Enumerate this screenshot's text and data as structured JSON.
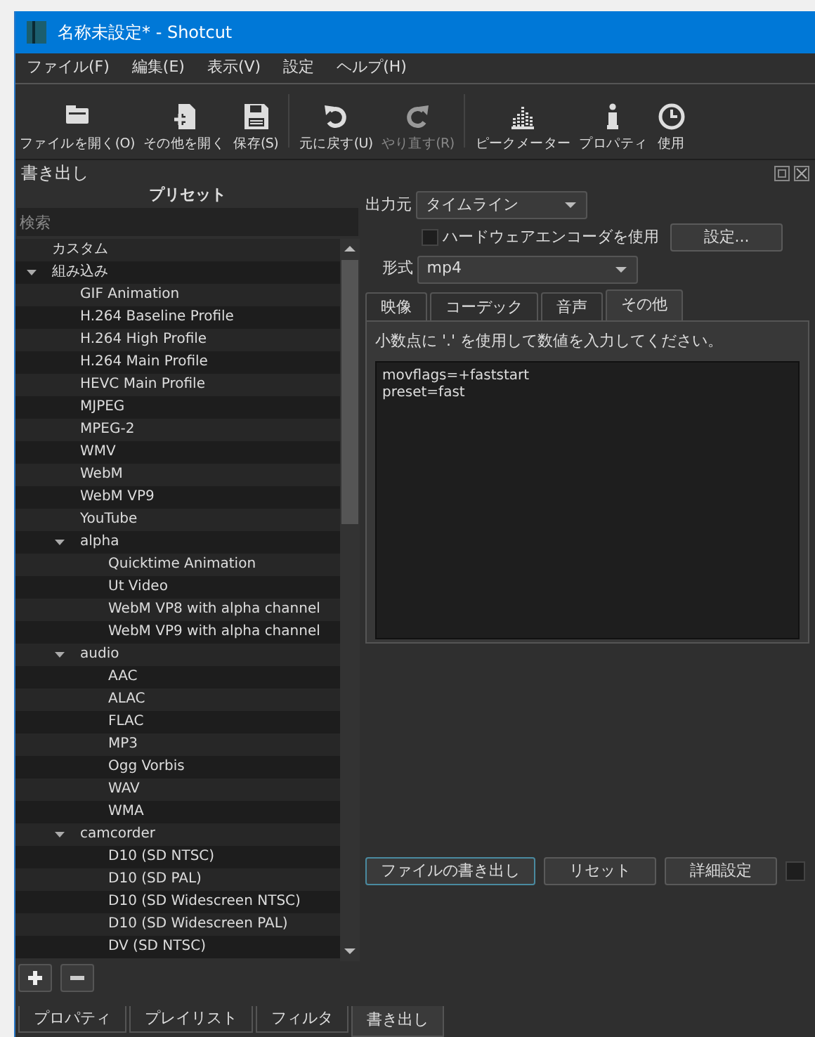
{
  "window": {
    "title": "名称未設定* - Shotcut"
  },
  "menu": [
    "ファイル(F)",
    "編集(E)",
    "表示(V)",
    "設定",
    "ヘルプ(H)"
  ],
  "toolbar": [
    {
      "kind": "open",
      "label": "ファイルを開く(O)",
      "disabled": false
    },
    {
      "kind": "openother",
      "label": "その他を開く",
      "disabled": false
    },
    {
      "kind": "save",
      "label": "保存(S)",
      "disabled": false
    },
    {
      "kind": "undo",
      "label": "元に戻す(U)",
      "disabled": false
    },
    {
      "kind": "redo",
      "label": "やり直す(R)",
      "disabled": true
    },
    {
      "kind": "meter",
      "label": "ピークメーター",
      "disabled": false
    },
    {
      "kind": "info",
      "label": "プロパティ",
      "disabled": false
    },
    {
      "kind": "clock",
      "label": "使用",
      "disabled": false
    }
  ],
  "dock": {
    "title": "書き出し"
  },
  "presets": {
    "title": "プリセット",
    "search": {
      "placeholder": "検索"
    },
    "tree": [
      {
        "label": "カスタム"
      },
      {
        "label": "組み込み",
        "expanded": true,
        "children": [
          {
            "label": "GIF Animation"
          },
          {
            "label": "H.264 Baseline Profile"
          },
          {
            "label": "H.264 High Profile"
          },
          {
            "label": "H.264 Main Profile"
          },
          {
            "label": "HEVC Main Profile"
          },
          {
            "label": "MJPEG"
          },
          {
            "label": "MPEG-2"
          },
          {
            "label": "WMV"
          },
          {
            "label": "WebM"
          },
          {
            "label": "WebM VP9"
          },
          {
            "label": "YouTube"
          },
          {
            "label": "alpha",
            "expanded": true,
            "children": [
              {
                "label": "Quicktime Animation"
              },
              {
                "label": "Ut Video"
              },
              {
                "label": "WebM VP8 with alpha channel"
              },
              {
                "label": "WebM VP9 with alpha channel"
              }
            ]
          },
          {
            "label": "audio",
            "expanded": true,
            "children": [
              {
                "label": "AAC"
              },
              {
                "label": "ALAC"
              },
              {
                "label": "FLAC"
              },
              {
                "label": "MP3"
              },
              {
                "label": "Ogg Vorbis"
              },
              {
                "label": "WAV"
              },
              {
                "label": "WMA"
              }
            ]
          },
          {
            "label": "camcorder",
            "expanded": true,
            "children": [
              {
                "label": "D10 (SD NTSC)"
              },
              {
                "label": "D10 (SD PAL)"
              },
              {
                "label": "D10 (SD Widescreen NTSC)"
              },
              {
                "label": "D10 (SD Widescreen PAL)"
              },
              {
                "label": "DV (SD NTSC)"
              }
            ]
          }
        ]
      }
    ]
  },
  "export": {
    "source": {
      "label": "出力元",
      "value": "タイムライン"
    },
    "hardware_encoder": {
      "label": "ハードウェアエンコーダを使用",
      "checked": false
    },
    "configure_button": "設定...",
    "format": {
      "label": "形式",
      "value": "mp4"
    },
    "tabs": [
      {
        "label": "映像",
        "selected": false
      },
      {
        "label": "コーデック",
        "selected": false
      },
      {
        "label": "音声",
        "selected": false
      },
      {
        "label": "その他",
        "selected": true
      }
    ],
    "hint": "小数点に '.' を使用して数値を入力してください。",
    "options": "movflags=+faststart\npreset=fast",
    "buttons": [
      "ファイルの書き出し",
      "リセット",
      "詳細設定"
    ],
    "extra_checkbox": {
      "checked": false
    }
  },
  "bottom_tabs": [
    {
      "label": "プロパティ",
      "selected": false
    },
    {
      "label": "プレイリスト",
      "selected": false
    },
    {
      "label": "フィルタ",
      "selected": false
    },
    {
      "label": "書き出し",
      "selected": true
    }
  ]
}
